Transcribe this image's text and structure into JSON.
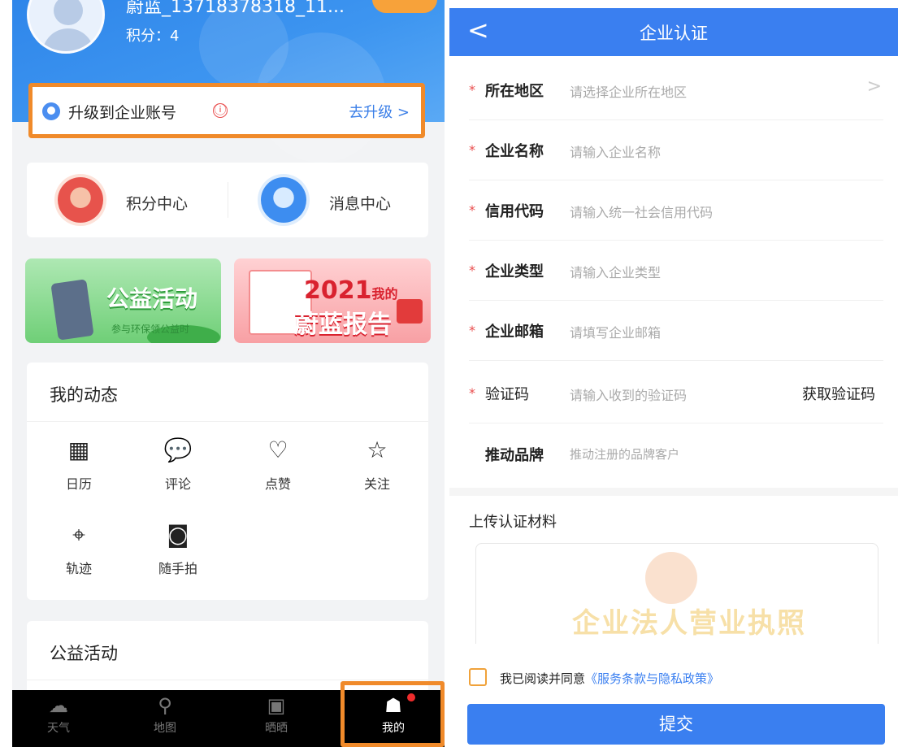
{
  "left": {
    "profile": {
      "username": "蔚蓝_13718378318_11...",
      "score": "积分：4"
    },
    "upgrade": {
      "label": "升级到企业账号",
      "warn_icon": "ⓘ",
      "link": "去升级 >"
    },
    "centers": [
      {
        "label": "积分中心",
        "icon": "points-icon"
      },
      {
        "label": "消息中心",
        "icon": "message-icon"
      }
    ],
    "banners": {
      "charity": {
        "title": "公益活动",
        "subtitle": "参与环保领公益时"
      },
      "report": {
        "year": "2021",
        "mine": "我的",
        "title": "蔚蓝报告"
      }
    },
    "dynamics": {
      "title": "我的动态",
      "items": [
        {
          "label": "日历",
          "icon": "calendar-icon",
          "glyph": "▦"
        },
        {
          "label": "评论",
          "icon": "comment-icon",
          "glyph": "💬"
        },
        {
          "label": "点赞",
          "icon": "heart-icon",
          "glyph": "♡"
        },
        {
          "label": "关注",
          "icon": "star-icon",
          "glyph": "☆"
        },
        {
          "label": "轨迹",
          "icon": "location-icon",
          "glyph": "⌖"
        },
        {
          "label": "随手拍",
          "icon": "camera-icon",
          "glyph": "◙"
        }
      ]
    },
    "charity_section": {
      "title": "公益活动"
    },
    "tabs": [
      {
        "label": "天气",
        "icon": "weather-icon",
        "glyph": "☁"
      },
      {
        "label": "地图",
        "icon": "map-icon",
        "glyph": "⚲"
      },
      {
        "label": "晒晒",
        "icon": "share-icon",
        "glyph": "▣"
      },
      {
        "label": "我的",
        "icon": "profile-icon",
        "glyph": "☗"
      }
    ]
  },
  "right": {
    "nav": {
      "back": "<",
      "title": "企业认证"
    },
    "fields": [
      {
        "label": "所在地区",
        "value": "请选择企业所在地区",
        "required": "*"
      },
      {
        "label": "企业名称",
        "value": "请输入企业名称",
        "required": "*"
      },
      {
        "label": "信用代码",
        "value": "请输入统一社会信用代码",
        "required": "*"
      },
      {
        "label": "企业类型",
        "value": "请输入企业类型",
        "required": "*"
      },
      {
        "label": "企业邮箱",
        "value": "请填写企业邮箱",
        "required": "*"
      },
      {
        "label": "验证码",
        "value": "请输入收到的验证码",
        "required": "*",
        "action": "获取验证码"
      },
      {
        "label": "推动品牌",
        "value": "推动注册的品牌客户"
      }
    ],
    "upload": {
      "title": "上传认证材料",
      "watermark": "企业法人营业执照"
    },
    "agreement": {
      "text": "我已阅读并同意",
      "policy": "《服务条款与隐私政策》"
    },
    "submit": "提交",
    "colors": {
      "primary": "#3a7ff0",
      "highlight": "#f08a2a",
      "required": "#e94d4d"
    }
  }
}
